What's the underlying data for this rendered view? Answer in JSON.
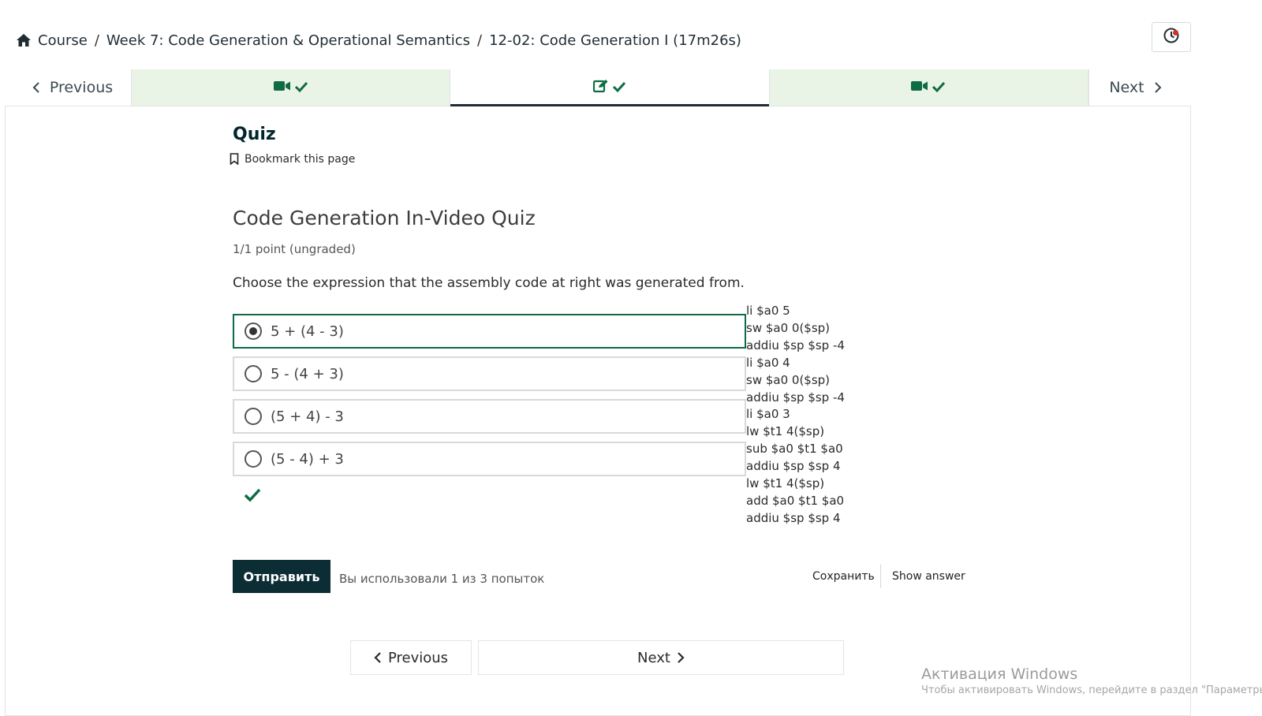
{
  "breadcrumb": {
    "course": "Course",
    "separator": "/",
    "week": "Week 7: Code Generation & Operational Semantics",
    "unit": "12-02: Code Generation I (17m26s)"
  },
  "sequence_nav": {
    "previous_label": "Previous",
    "next_label": "Next",
    "tabs": [
      {
        "icon": "video-icon",
        "status": "completed"
      },
      {
        "icon": "problem-icon",
        "status": "completed",
        "active": true
      },
      {
        "icon": "video-icon",
        "status": "completed"
      }
    ]
  },
  "unit": {
    "title": "Quiz",
    "bookmark_label": "Bookmark this page"
  },
  "problem": {
    "title": "Code Generation In-Video Quiz",
    "points": "1/1 point (ungraded)",
    "question": "Choose the expression that the assembly code at right was generated from.",
    "options": [
      {
        "label": "5 + (4 - 3)",
        "selected": true
      },
      {
        "label": "5 - (4 + 3)",
        "selected": false
      },
      {
        "label": "(5 + 4) - 3",
        "selected": false
      },
      {
        "label": "(5 - 4) + 3",
        "selected": false
      }
    ],
    "assembly": [
      "li $a0 5",
      "sw $a0 0($sp)",
      "addiu $sp $sp -4",
      "li $a0 4",
      "sw $a0 0($sp)",
      "addiu $sp $sp -4",
      "li $a0 3",
      "lw $t1 4($sp)",
      "sub $a0 $t1 $a0",
      "addiu $sp $sp 4",
      "lw $t1 4($sp)",
      "add $a0 $t1 $a0",
      "addiu $sp $sp 4"
    ],
    "result": "correct"
  },
  "actions": {
    "submit_label": "Отправить",
    "attempts_text": "Вы использовали 1 из 3 попыток",
    "save_label": "Сохранить",
    "show_answer_label": "Show answer"
  },
  "bottom_nav": {
    "previous_label": "Previous",
    "next_label": "Next"
  },
  "watermark": {
    "title": "Активация Windows",
    "subtitle": "Чтобы активировать Windows, перейдите в раздел \"Параметры\"."
  },
  "colors": {
    "completed_tab_bg": "#eaf4e6",
    "success_green": "#0e6b43",
    "primary_dark": "#0b2d33",
    "notification_dot": "#d23228"
  }
}
